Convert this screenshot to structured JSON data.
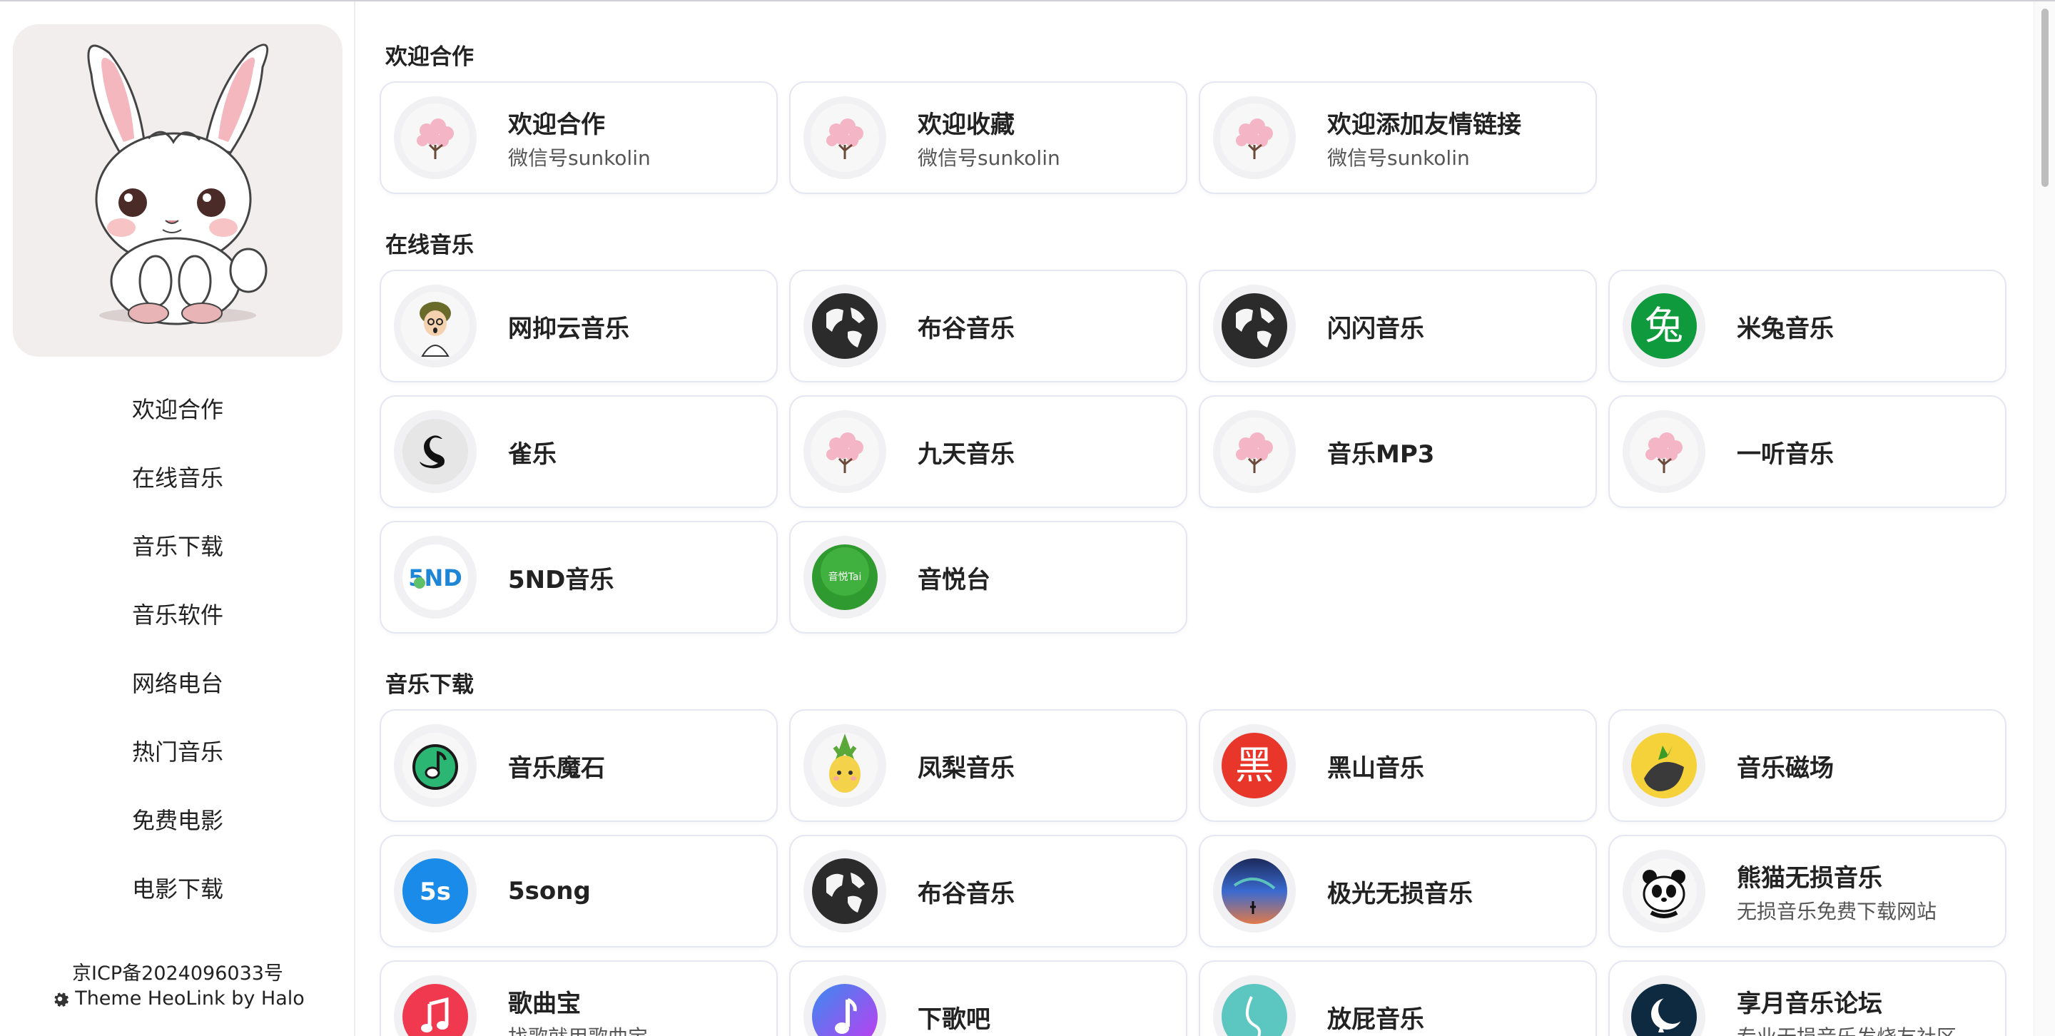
{
  "sidebar": {
    "avatar_alt": "bunny-avatar",
    "nav": [
      {
        "label": "欢迎合作"
      },
      {
        "label": "在线音乐"
      },
      {
        "label": "音乐下载"
      },
      {
        "label": "音乐软件"
      },
      {
        "label": "网络电台"
      },
      {
        "label": "热门音乐"
      },
      {
        "label": "免费电影"
      },
      {
        "label": "电影下载"
      }
    ],
    "footer": {
      "icp": "京ICP备2024096033号",
      "theme": "Theme HeoLink by Halo"
    }
  },
  "sections": [
    {
      "title": "欢迎合作",
      "items": [
        {
          "name": "欢迎合作",
          "desc": "微信号sunkolin",
          "icon": "cherry-blossom-icon"
        },
        {
          "name": "欢迎收藏",
          "desc": "微信号sunkolin",
          "icon": "cherry-blossom-icon"
        },
        {
          "name": "欢迎添加友情链接",
          "desc": "微信号sunkolin",
          "icon": "cherry-blossom-icon"
        }
      ]
    },
    {
      "title": "在线音乐",
      "items": [
        {
          "name": "网抑云音乐",
          "desc": "",
          "icon": "cartoon-man-icon"
        },
        {
          "name": "布谷音乐",
          "desc": "",
          "icon": "globe-icon"
        },
        {
          "name": "闪闪音乐",
          "desc": "",
          "icon": "globe-icon"
        },
        {
          "name": "米兔音乐",
          "desc": "",
          "icon": "mitu-logo-icon",
          "glyph": "兔"
        },
        {
          "name": "雀乐",
          "desc": "",
          "icon": "swan-icon"
        },
        {
          "name": "九天音乐",
          "desc": "",
          "icon": "cherry-blossom-icon"
        },
        {
          "name": "音乐MP3",
          "desc": "",
          "icon": "cherry-blossom-icon"
        },
        {
          "name": "一听音乐",
          "desc": "",
          "icon": "cherry-blossom-icon"
        },
        {
          "name": "5ND音乐",
          "desc": "",
          "icon": "5nd-logo-icon",
          "glyph": "5ND"
        },
        {
          "name": "音悦台",
          "desc": "",
          "icon": "yinyuetai-logo-icon",
          "glyph": "音悦Tai"
        }
      ]
    },
    {
      "title": "音乐下载",
      "items": [
        {
          "name": "音乐魔石",
          "desc": "",
          "icon": "music-note-icon"
        },
        {
          "name": "凤梨音乐",
          "desc": "",
          "icon": "pineapple-icon"
        },
        {
          "name": "黑山音乐",
          "desc": "",
          "icon": "heishan-logo-icon",
          "glyph": "黑"
        },
        {
          "name": "音乐磁场",
          "desc": "",
          "icon": "durian-icon"
        },
        {
          "name": "5song",
          "desc": "",
          "icon": "5song-logo-icon",
          "glyph": "5s"
        },
        {
          "name": "布谷音乐",
          "desc": "",
          "icon": "globe-icon"
        },
        {
          "name": "极光无损音乐",
          "desc": "",
          "icon": "aurora-icon"
        },
        {
          "name": "熊猫无损音乐",
          "desc": "无损音乐免费下载网站",
          "icon": "panda-icon"
        },
        {
          "name": "歌曲宝",
          "desc": "找歌就用歌曲宝",
          "icon": "apple-music-icon"
        },
        {
          "name": "下歌吧",
          "desc": "",
          "icon": "music-note-gradient-icon"
        },
        {
          "name": "放屁音乐",
          "desc": "",
          "icon": "teal-wave-icon"
        },
        {
          "name": "享月音乐论坛",
          "desc": "专业无损音乐发烧友社区",
          "icon": "moon-logo-icon"
        }
      ]
    }
  ]
}
